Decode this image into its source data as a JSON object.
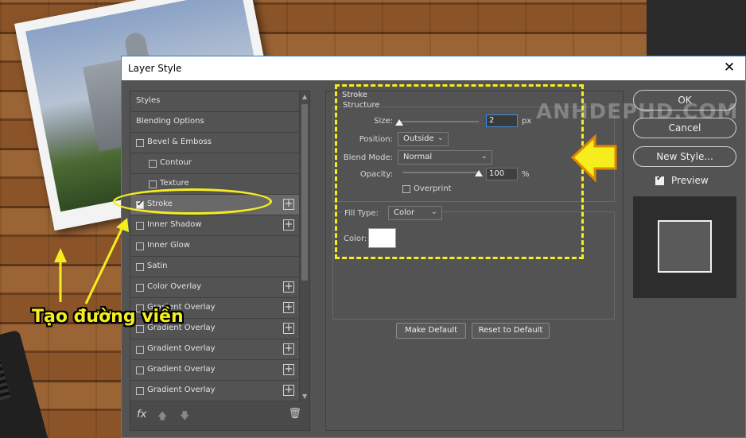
{
  "dialog": {
    "title": "Layer Style",
    "close_glyph": "✕"
  },
  "styles_list": [
    {
      "label": "Styles",
      "checkbox": false,
      "checked": false,
      "plus": false,
      "indent": 0,
      "active": false
    },
    {
      "label": "Blending Options",
      "checkbox": false,
      "checked": false,
      "plus": false,
      "indent": 0,
      "active": false
    },
    {
      "label": "Bevel & Emboss",
      "checkbox": true,
      "checked": false,
      "plus": false,
      "indent": 0,
      "active": false
    },
    {
      "label": "Contour",
      "checkbox": true,
      "checked": false,
      "plus": false,
      "indent": 1,
      "active": false
    },
    {
      "label": "Texture",
      "checkbox": true,
      "checked": false,
      "plus": false,
      "indent": 1,
      "active": false
    },
    {
      "label": "Stroke",
      "checkbox": true,
      "checked": true,
      "plus": true,
      "indent": 0,
      "active": true
    },
    {
      "label": "Inner Shadow",
      "checkbox": true,
      "checked": false,
      "plus": true,
      "indent": 0,
      "active": false
    },
    {
      "label": "Inner Glow",
      "checkbox": true,
      "checked": false,
      "plus": false,
      "indent": 0,
      "active": false
    },
    {
      "label": "Satin",
      "checkbox": true,
      "checked": false,
      "plus": false,
      "indent": 0,
      "active": false
    },
    {
      "label": "Color Overlay",
      "checkbox": true,
      "checked": false,
      "plus": true,
      "indent": 0,
      "active": false
    },
    {
      "label": "Gradient Overlay",
      "checkbox": true,
      "checked": false,
      "plus": true,
      "indent": 0,
      "active": false
    },
    {
      "label": "Gradient Overlay",
      "checkbox": true,
      "checked": false,
      "plus": true,
      "indent": 0,
      "active": false
    },
    {
      "label": "Gradient Overlay",
      "checkbox": true,
      "checked": false,
      "plus": true,
      "indent": 0,
      "active": false
    },
    {
      "label": "Gradient Overlay",
      "checkbox": true,
      "checked": false,
      "plus": true,
      "indent": 0,
      "active": false
    },
    {
      "label": "Gradient Overlay",
      "checkbox": true,
      "checked": false,
      "plus": true,
      "indent": 0,
      "active": false
    }
  ],
  "left_bottom": {
    "fx_label": "fx",
    "up_glyph": "🡅",
    "down_glyph": "🡇",
    "trash_glyph": "🗑"
  },
  "stroke": {
    "heading": "Stroke",
    "structure_title": "Structure",
    "size_label": "Size:",
    "size_value": "2",
    "size_unit": "px",
    "position_label": "Position:",
    "position_value": "Outside",
    "blend_mode_label": "Blend Mode:",
    "blend_mode_value": "Normal",
    "opacity_label": "Opacity:",
    "opacity_value": "100",
    "opacity_unit": "%",
    "opacity_fraction": 1.0,
    "size_fraction": 0.0,
    "overprint_label": "Overprint",
    "fill_type_label": "Fill Type:",
    "fill_type_value": "Color",
    "color_label": "Color:",
    "color_value": "#ffffff"
  },
  "buttons": {
    "make_default": "Make Default",
    "reset_default": "Reset to Default",
    "ok": "OK",
    "cancel": "Cancel",
    "new_style": "New Style...",
    "preview_label": "Preview"
  },
  "annotation": {
    "text": "Tạo đường viền",
    "accent_color": "#f5ee1e"
  },
  "watermark": {
    "text": "ANHDEPHD.COM"
  }
}
